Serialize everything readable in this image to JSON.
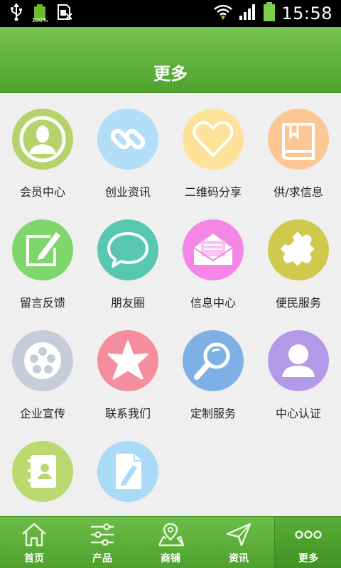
{
  "status_bar": {
    "time": "15:58",
    "battery_small_label": "100%",
    "usb_icon": "usb-icon",
    "sim_icon": "sim-card-icon",
    "wifi_icon": "wifi-icon",
    "signal_icon": "cell-signal-icon",
    "battery_icon": "battery-icon"
  },
  "header": {
    "title": "更多"
  },
  "menu": {
    "items": [
      {
        "label": "会员中心",
        "icon": "member-icon",
        "color": "#b6d36b"
      },
      {
        "label": "创业资讯",
        "icon": "link-icon",
        "color": "#b3def7"
      },
      {
        "label": "二维码分享",
        "icon": "heart-icon",
        "color": "#fde39a"
      },
      {
        "label": "供/求信息",
        "icon": "book-icon",
        "color": "#fbc795"
      },
      {
        "label": "留言反馈",
        "icon": "edit-icon",
        "color": "#7fd66a"
      },
      {
        "label": "朋友圈",
        "icon": "chat-bubble-icon",
        "color": "#58c7b0"
      },
      {
        "label": "信息中心",
        "icon": "mail-icon",
        "color": "#f487e6"
      },
      {
        "label": "便民服务",
        "icon": "puzzle-icon",
        "color": "#cfc94e"
      },
      {
        "label": "企业宣传",
        "icon": "film-reel-icon",
        "color": "#c6ccd8"
      },
      {
        "label": "联系我们",
        "icon": "star-icon",
        "color": "#f58e9c"
      },
      {
        "label": "定制服务",
        "icon": "magnifier-icon",
        "color": "#7eb0e5"
      },
      {
        "label": "中心认证",
        "icon": "user-icon",
        "color": "#b39ae8"
      },
      {
        "label": "",
        "icon": "contacts-book-icon",
        "color": "#bcd870"
      },
      {
        "label": "",
        "icon": "document-edit-icon",
        "color": "#a9daf6"
      }
    ]
  },
  "bottom_nav": {
    "items": [
      {
        "label": "首页",
        "icon": "home-icon"
      },
      {
        "label": "产品",
        "icon": "sliders-icon"
      },
      {
        "label": "商铺",
        "icon": "map-icon"
      },
      {
        "label": "资讯",
        "icon": "send-icon"
      },
      {
        "label": "更多",
        "icon": "more-icon",
        "active": true
      }
    ]
  }
}
